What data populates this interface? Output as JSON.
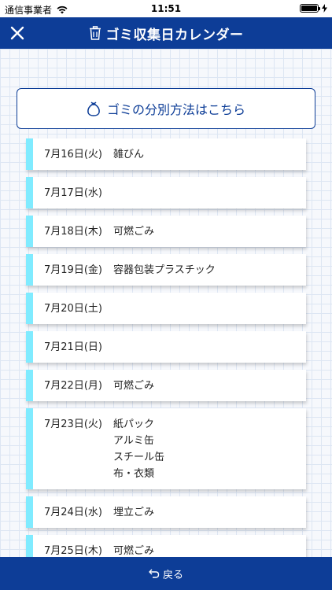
{
  "status_bar": {
    "carrier": "通信事業者",
    "time": "11:51"
  },
  "header": {
    "title": "ゴミ収集日カレンダー",
    "icon": "trash-can-icon",
    "close_icon": "close-icon"
  },
  "sort_button": {
    "label": "ゴミの分別方法はこちら",
    "icon": "bag-icon"
  },
  "days": [
    {
      "date": "7月16日(火)",
      "items": [
        "雑びん"
      ]
    },
    {
      "date": "7月17日(水)",
      "items": []
    },
    {
      "date": "7月18日(木)",
      "items": [
        "可燃ごみ"
      ]
    },
    {
      "date": "7月19日(金)",
      "items": [
        "容器包装プラスチック"
      ]
    },
    {
      "date": "7月20日(土)",
      "items": []
    },
    {
      "date": "7月21日(日)",
      "items": []
    },
    {
      "date": "7月22日(月)",
      "items": [
        "可燃ごみ"
      ]
    },
    {
      "date": "7月23日(火)",
      "items": [
        "紙パック",
        "アルミ缶",
        "スチール缶",
        "布・衣類"
      ]
    },
    {
      "date": "7月24日(水)",
      "items": [
        "埋立ごみ"
      ]
    },
    {
      "date": "7月25日(木)",
      "items": [
        "可燃ごみ"
      ]
    }
  ],
  "footer": {
    "back_label": "戻る",
    "back_icon": "back-arrow-icon"
  },
  "colors": {
    "primary": "#0d3d97",
    "accent_stripe": "#80ebff",
    "grid_line": "#dde6f3"
  }
}
